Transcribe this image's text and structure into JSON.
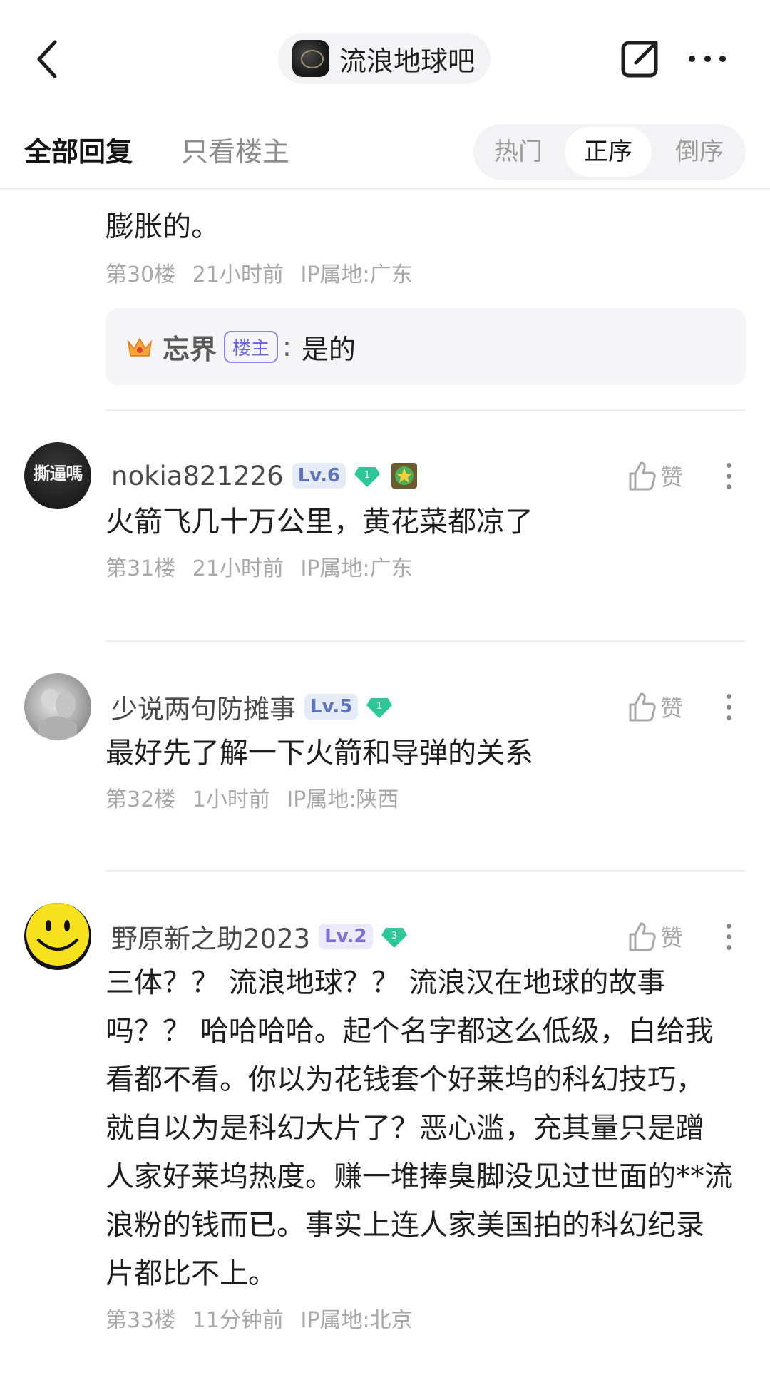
{
  "header": {
    "forum_name": "流浪地球吧"
  },
  "tabs": {
    "all_replies": "全部回复",
    "owner_only": "只看楼主",
    "sort_hot": "热门",
    "sort_asc": "正序",
    "sort_desc": "倒序",
    "sort_selected": "正序"
  },
  "partial_post": {
    "text": "膨胀的。",
    "floor": "第30楼",
    "time": "21小时前",
    "ip": "IP属地:广东",
    "reply": {
      "name": "忘界",
      "badge": "楼主",
      "colon": ":",
      "text": "是的"
    }
  },
  "comments": [
    {
      "username": "nokia821226",
      "level": "Lv.6",
      "gem_count": "1",
      "like_label": "赞",
      "text": "火箭飞几十万公里，黄花菜都凉了",
      "floor": "第31楼",
      "time": "21小时前",
      "ip": "IP属地:广东",
      "avatar_text": "撕逼嗎"
    },
    {
      "username": "少说两句防摊事",
      "level": "Lv.5",
      "gem_count": "1",
      "like_label": "赞",
      "text": "最好先了解一下火箭和导弹的关系",
      "floor": "第32楼",
      "time": "1小时前",
      "ip": "IP属地:陕西"
    },
    {
      "username": "野原新之助2023",
      "level": "Lv.2",
      "gem_count": "3",
      "like_label": "赞",
      "text_lines": [
        "三体？？ 流浪地球？？ 流浪汉在地球的故事",
        "吗？？ 哈哈哈哈。起个名字都这么低级，白给我",
        "看都不看。你以为花钱套个好莱坞的科幻技巧，",
        "就自以为是科幻大片了？恶心滥，充其量只是蹭",
        "人家好莱坞热度。赚一堆捧臭脚没见过世面的**流",
        "浪粉的钱而已。事实上连人家美国拍的科幻纪录",
        "片都比不上。"
      ],
      "floor": "第33楼",
      "time": "11分钟前",
      "ip": "IP属地:北京"
    }
  ],
  "colors": {
    "accent": "#6a63e0",
    "text_primary": "#1e1e1e",
    "text_meta": "#a8a8a8",
    "gem_teal": "#2ec79a"
  }
}
